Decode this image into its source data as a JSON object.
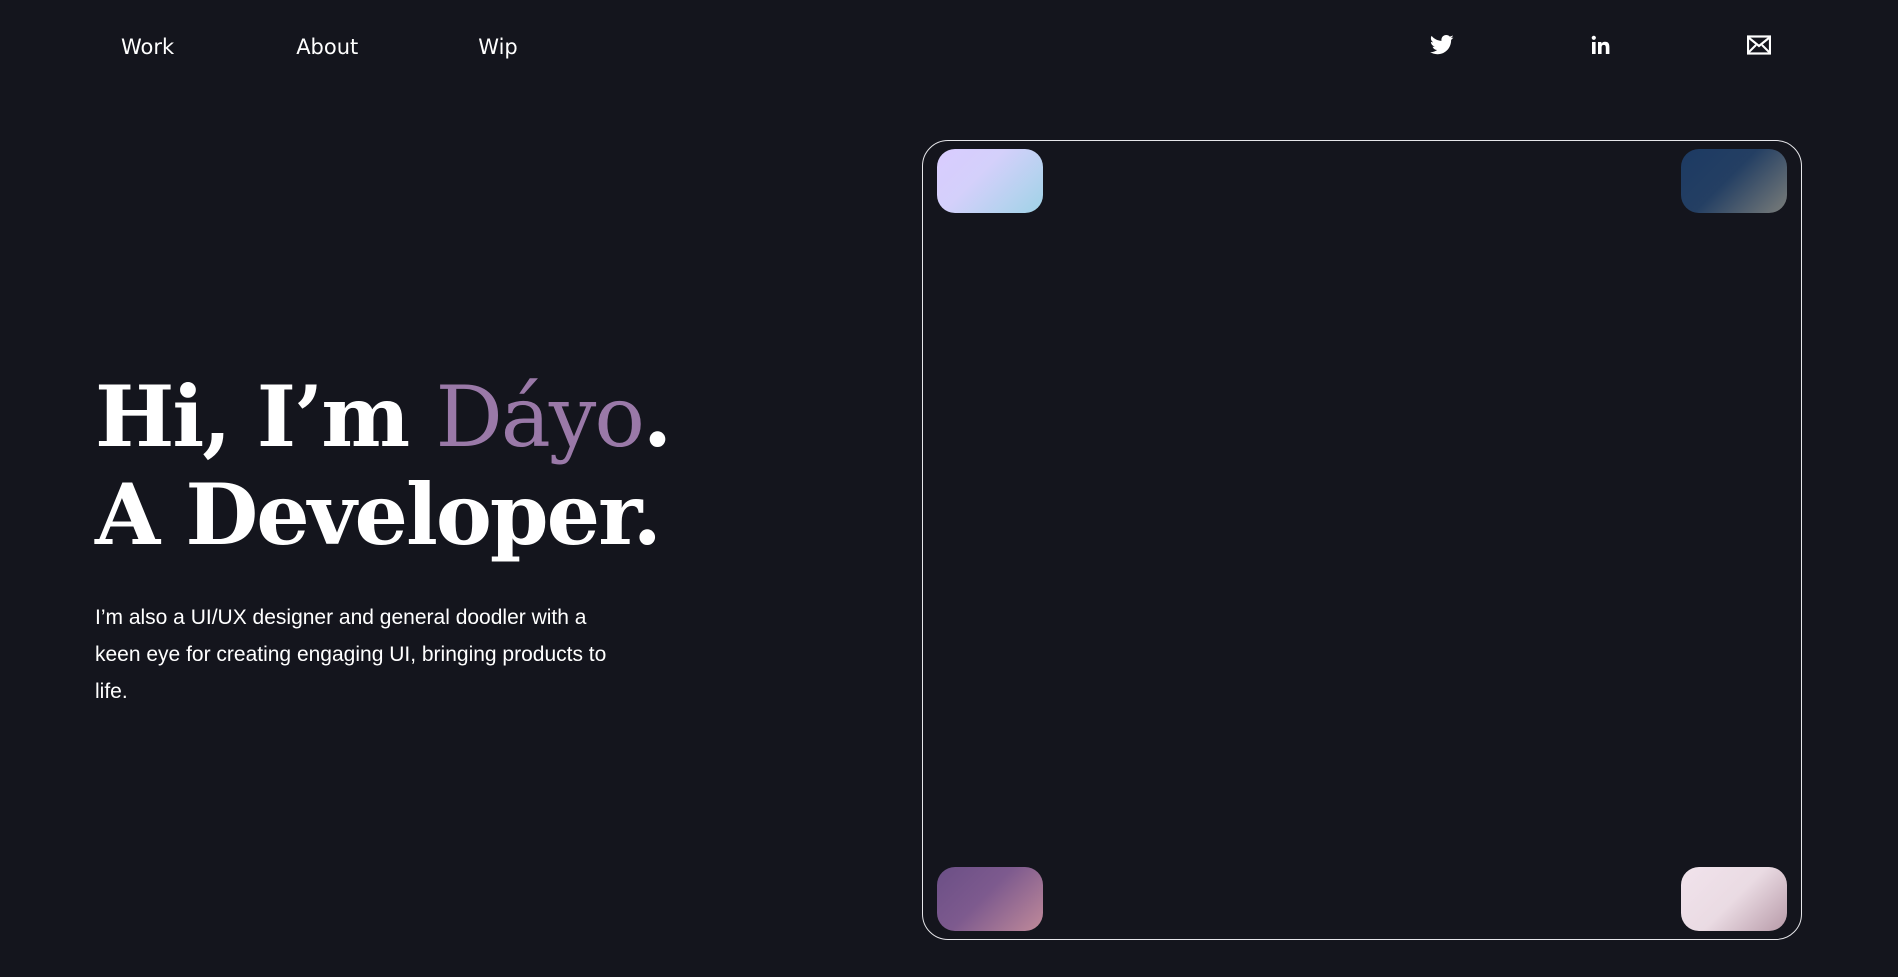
{
  "nav": {
    "items": [
      {
        "label": "Work"
      },
      {
        "label": "About"
      },
      {
        "label": "Wip"
      }
    ]
  },
  "social": {
    "icons": [
      "twitter-icon",
      "linkedin-icon",
      "mail-icon"
    ]
  },
  "hero": {
    "line1_prefix": "Hi, I’m ",
    "name": "Dáyo",
    "line1_suffix": ".",
    "line2": "A Developer.",
    "subtitle": "I’m also a UI/UX designer and general doodler with a keen eye for creating engaging UI, bringing products to life."
  },
  "colors": {
    "background": "#14151d",
    "text": "#ffffff",
    "accent_name": "#9a79a8",
    "frame_border": "#e6e6ea"
  }
}
